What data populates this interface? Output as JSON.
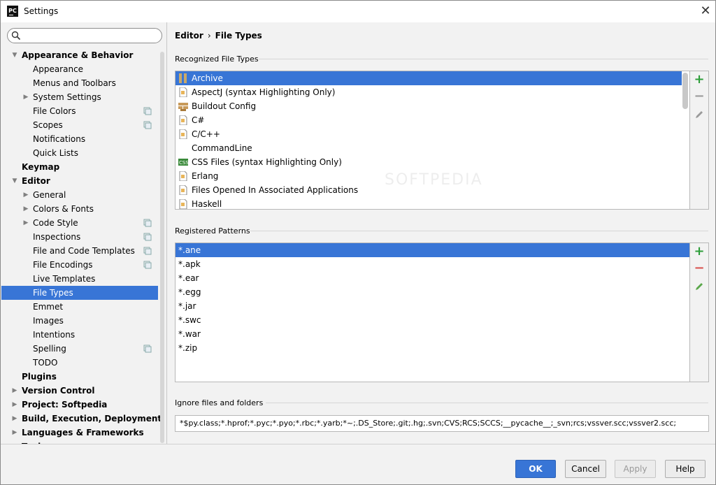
{
  "window": {
    "title": "Settings",
    "app_icon_text": "PC"
  },
  "search": {
    "placeholder": ""
  },
  "sidebar": {
    "items": [
      {
        "label": "Appearance & Behavior",
        "level": 0,
        "bold": true,
        "expanded": true,
        "arrow": "down",
        "icon": false
      },
      {
        "label": "Appearance",
        "level": 1,
        "bold": false,
        "arrow": "none",
        "icon": false
      },
      {
        "label": "Menus and Toolbars",
        "level": 1,
        "bold": false,
        "arrow": "none",
        "icon": false
      },
      {
        "label": "System Settings",
        "level": 1,
        "bold": false,
        "arrow": "right",
        "icon": false
      },
      {
        "label": "File Colors",
        "level": 1,
        "bold": false,
        "arrow": "none",
        "icon": true
      },
      {
        "label": "Scopes",
        "level": 1,
        "bold": false,
        "arrow": "none",
        "icon": true
      },
      {
        "label": "Notifications",
        "level": 1,
        "bold": false,
        "arrow": "none",
        "icon": false
      },
      {
        "label": "Quick Lists",
        "level": 1,
        "bold": false,
        "arrow": "none",
        "icon": false
      },
      {
        "label": "Keymap",
        "level": 0,
        "bold": true,
        "arrow": "none",
        "icon": false
      },
      {
        "label": "Editor",
        "level": 0,
        "bold": true,
        "arrow": "down",
        "icon": false
      },
      {
        "label": "General",
        "level": 1,
        "bold": false,
        "arrow": "right",
        "icon": false
      },
      {
        "label": "Colors & Fonts",
        "level": 1,
        "bold": false,
        "arrow": "right",
        "icon": false
      },
      {
        "label": "Code Style",
        "level": 1,
        "bold": false,
        "arrow": "right",
        "icon": true
      },
      {
        "label": "Inspections",
        "level": 1,
        "bold": false,
        "arrow": "none",
        "icon": true
      },
      {
        "label": "File and Code Templates",
        "level": 1,
        "bold": false,
        "arrow": "none",
        "icon": true
      },
      {
        "label": "File Encodings",
        "level": 1,
        "bold": false,
        "arrow": "none",
        "icon": true
      },
      {
        "label": "Live Templates",
        "level": 1,
        "bold": false,
        "arrow": "none",
        "icon": false
      },
      {
        "label": "File Types",
        "level": 1,
        "bold": false,
        "arrow": "none",
        "icon": false,
        "selected": true
      },
      {
        "label": "Emmet",
        "level": 1,
        "bold": false,
        "arrow": "none",
        "icon": false
      },
      {
        "label": "Images",
        "level": 1,
        "bold": false,
        "arrow": "none",
        "icon": false
      },
      {
        "label": "Intentions",
        "level": 1,
        "bold": false,
        "arrow": "none",
        "icon": false
      },
      {
        "label": "Spelling",
        "level": 1,
        "bold": false,
        "arrow": "none",
        "icon": true
      },
      {
        "label": "TODO",
        "level": 1,
        "bold": false,
        "arrow": "none",
        "icon": false
      },
      {
        "label": "Plugins",
        "level": 0,
        "bold": true,
        "arrow": "none",
        "icon": false
      },
      {
        "label": "Version Control",
        "level": 0,
        "bold": true,
        "arrow": "right",
        "icon": false
      },
      {
        "label": "Project: Softpedia",
        "level": 0,
        "bold": true,
        "arrow": "right",
        "icon": false
      },
      {
        "label": "Build, Execution, Deployment",
        "level": 0,
        "bold": true,
        "arrow": "right",
        "icon": false
      },
      {
        "label": "Languages & Frameworks",
        "level": 0,
        "bold": true,
        "arrow": "right",
        "icon": false
      },
      {
        "label": "Tools",
        "level": 0,
        "bold": true,
        "arrow": "right",
        "icon": false
      }
    ]
  },
  "breadcrumb": {
    "parent": "Editor",
    "separator": "›",
    "current": "File Types"
  },
  "recognized": {
    "title": "Recognized File Types",
    "items": [
      {
        "label": "Archive",
        "icon": "archive-icon",
        "selected": true
      },
      {
        "label": "AspectJ (syntax Highlighting Only)",
        "icon": "file-icon"
      },
      {
        "label": "Buildout Config",
        "icon": "buildout-icon"
      },
      {
        "label": "C#",
        "icon": "file-icon"
      },
      {
        "label": "C/C++",
        "icon": "file-icon"
      },
      {
        "label": "CommandLine",
        "icon": "none"
      },
      {
        "label": "CSS Files (syntax Highlighting Only)",
        "icon": "css-icon"
      },
      {
        "label": "Erlang",
        "icon": "file-icon"
      },
      {
        "label": "Files Opened In Associated Applications",
        "icon": "file-icon"
      },
      {
        "label": "Haskell",
        "icon": "file-icon"
      }
    ]
  },
  "patterns": {
    "title": "Registered Patterns",
    "items": [
      {
        "label": "*.ane",
        "selected": true
      },
      {
        "label": "*.apk"
      },
      {
        "label": "*.ear"
      },
      {
        "label": "*.egg"
      },
      {
        "label": "*.jar"
      },
      {
        "label": "*.swc"
      },
      {
        "label": "*.war"
      },
      {
        "label": "*.zip"
      }
    ]
  },
  "ignore": {
    "title": "Ignore files and folders",
    "value": "*$py.class;*.hprof;*.pyc;*.pyo;*.rbc;*.yarb;*~;.DS_Store;.git;.hg;.svn;CVS;RCS;SCCS;__pycache__;_svn;rcs;vssver.scc;vssver2.scc;"
  },
  "buttons": {
    "ok": "OK",
    "cancel": "Cancel",
    "apply": "Apply",
    "help": "Help"
  },
  "colors": {
    "selection": "#3875d6",
    "add": "#2e9e3a",
    "remove": "#d9534f",
    "edit": "#5aa74a"
  }
}
